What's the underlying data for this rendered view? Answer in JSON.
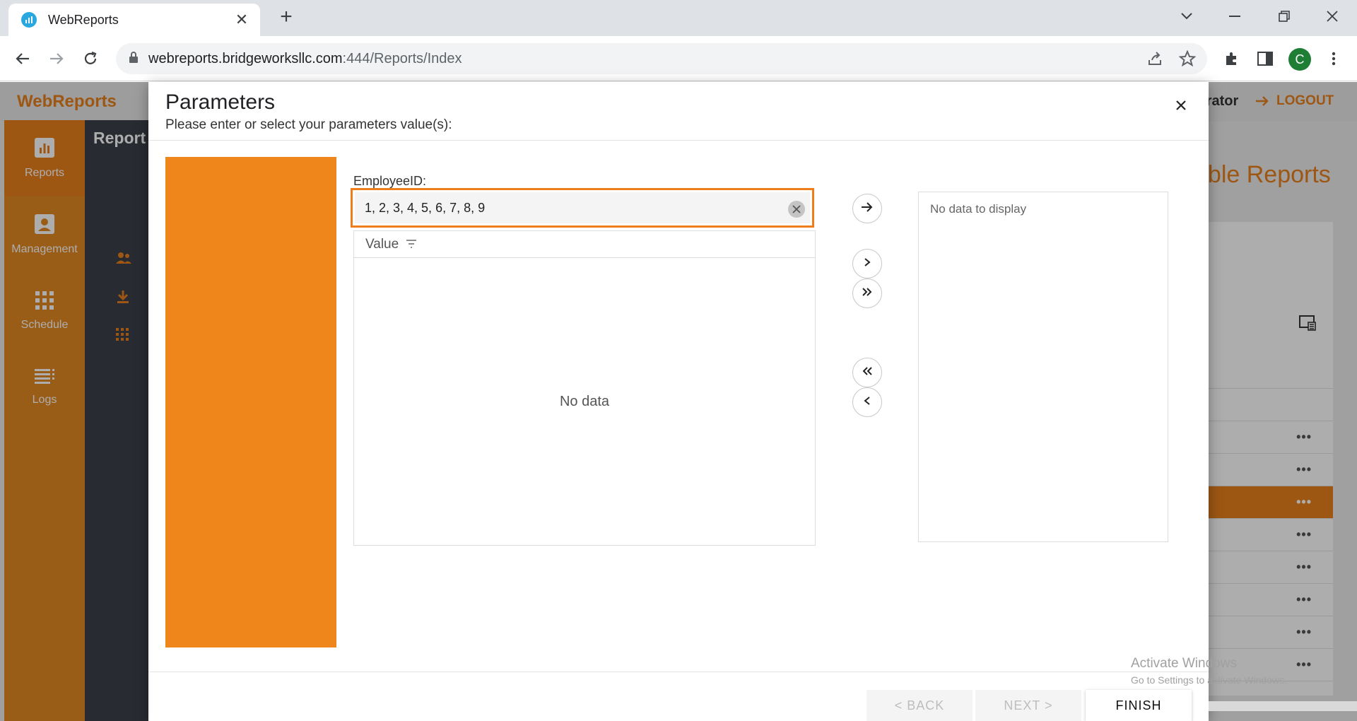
{
  "browser": {
    "tab_title": "WebReports",
    "url_host": "webreports.bridgeworksllc.com",
    "url_path": ":444/Reports/Index",
    "profile_initial": "C"
  },
  "app": {
    "logo": "WebReports",
    "user_partial": "trator",
    "logout": "LOGOUT",
    "nav": [
      {
        "label": "Reports",
        "icon": "bar-chart-icon"
      },
      {
        "label": "Management",
        "icon": "person-icon"
      },
      {
        "label": "Schedule",
        "icon": "grid-icon"
      },
      {
        "label": "Logs",
        "icon": "list-icon"
      }
    ],
    "sub_title": "Report",
    "main_title_partial": "able Reports",
    "row_more": "•••"
  },
  "dialog": {
    "title": "Parameters",
    "subtitle": "Please enter or select your parameters value(s):",
    "field_label": "EmployeeID:",
    "field_value": "1, 2, 3, 4, 5, 6, 7, 8, 9",
    "grid_header": "Value",
    "grid_empty": "No data",
    "target_empty": "No data to display",
    "buttons": {
      "back": "< BACK",
      "next": "NEXT >",
      "finish": "FINISH"
    }
  },
  "watermark": {
    "line1": "Activate Windows",
    "line2": "Go to Settings to activate Windows."
  },
  "colors": {
    "accent": "#ee861c",
    "sidebar": "#e48a22",
    "subsidebar": "#3b4049"
  }
}
